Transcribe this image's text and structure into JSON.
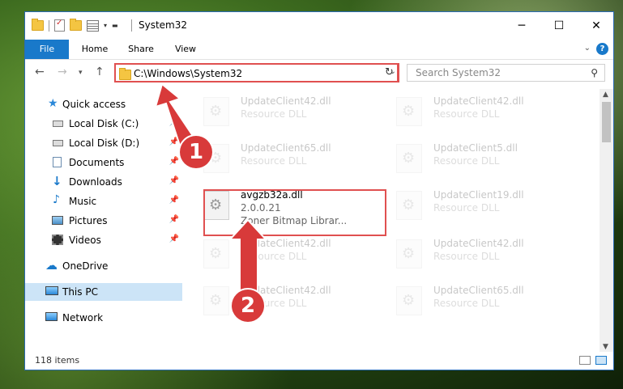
{
  "window": {
    "title": "System32",
    "minimize": "─",
    "maximize": "☐",
    "close": "✕"
  },
  "ribbon": {
    "tabs": [
      "File",
      "Home",
      "Share",
      "View"
    ],
    "help": "?"
  },
  "address": {
    "path": "C:\\Windows\\System32",
    "search_placeholder": "Search System32"
  },
  "sidebar": {
    "items": [
      {
        "label": "Quick access",
        "icon": "star-icon",
        "color": "#2b88d8"
      },
      {
        "label": "Local Disk (C:)",
        "icon": "drive-icon",
        "pinned": true
      },
      {
        "label": "Local Disk (D:)",
        "icon": "drive-icon",
        "pinned": true
      },
      {
        "label": "Documents",
        "icon": "documents-icon",
        "pinned": true
      },
      {
        "label": "Downloads",
        "icon": "download-icon",
        "pinned": true
      },
      {
        "label": "Music",
        "icon": "music-icon",
        "pinned": true
      },
      {
        "label": "Pictures",
        "icon": "pictures-icon",
        "pinned": true
      },
      {
        "label": "Videos",
        "icon": "videos-icon",
        "pinned": true
      },
      {
        "label": "OneDrive",
        "icon": "cloud-icon"
      },
      {
        "label": "This PC",
        "icon": "computer-icon",
        "selected": true
      },
      {
        "label": "Network",
        "icon": "network-icon"
      }
    ]
  },
  "files": [
    {
      "name": "UpdateClient42.dll",
      "desc": "Resource DLL",
      "faded": true
    },
    {
      "name": "UpdateClient42.dll",
      "desc": "Resource DLL",
      "faded": true
    },
    {
      "name": "UpdateClient65.dll",
      "desc": "Resource DLL",
      "faded": true
    },
    {
      "name": "UpdateClient5.dll",
      "desc": "Resource DLL",
      "faded": true
    },
    {
      "name": "avgzb32a.dll",
      "version": "2.0.0.21",
      "desc": "Zoner Bitmap Librar...",
      "faded": false
    },
    {
      "name": "UpdateClient19.dll",
      "desc": "Resource DLL",
      "faded": true
    },
    {
      "name": "UpdateClient42.dll",
      "desc": "Resource DLL",
      "faded": true
    },
    {
      "name": "UpdateClient42.dll",
      "desc": "Resource DLL",
      "faded": true
    },
    {
      "name": "UpdateClient42.dll",
      "desc": "Resource DLL",
      "faded": true
    },
    {
      "name": "UpdateClient65.dll",
      "desc": "Resource DLL",
      "faded": true
    }
  ],
  "status": {
    "count": "118 items"
  },
  "annotations": {
    "step1": "1",
    "step2": "2",
    "color": "#d83a3a"
  }
}
